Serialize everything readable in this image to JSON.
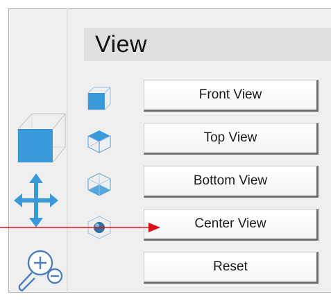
{
  "section": {
    "title": "View"
  },
  "toolbar": {
    "tools": [
      {
        "icon": "cube-icon"
      },
      {
        "icon": "move-arrows-icon"
      },
      {
        "icon": "zoom-icon"
      }
    ]
  },
  "view_buttons": [
    {
      "label": "Front View",
      "icon": "front-view-cube-icon"
    },
    {
      "label": "Top View",
      "icon": "top-view-cube-icon"
    },
    {
      "label": "Bottom View",
      "icon": "bottom-view-cube-icon"
    },
    {
      "label": "Center View",
      "icon": "center-view-cube-icon"
    },
    {
      "label": "Reset",
      "icon": ""
    }
  ],
  "colors": {
    "accent_blue": "#3a9ad9",
    "annotation_arrow": "#e0101a"
  }
}
